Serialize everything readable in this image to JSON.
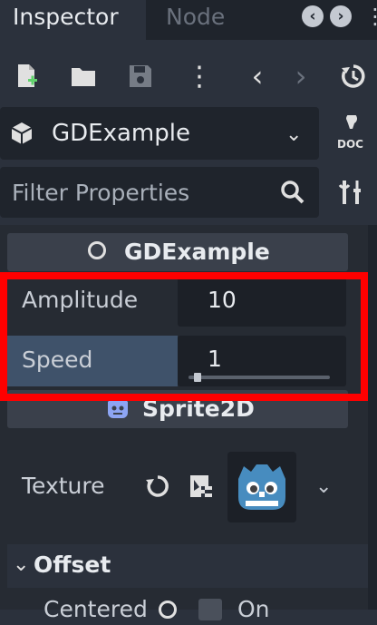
{
  "tabs": [
    {
      "label": "Inspector",
      "active": true
    },
    {
      "label": "Node",
      "active": false
    }
  ],
  "toolbar": {
    "icons": [
      "new-resource-icon",
      "open-folder-icon",
      "save-icon",
      "more-menu-icon",
      "history-back-icon",
      "history-forward-icon",
      "history-icon"
    ]
  },
  "object_selector": {
    "label": "GDExample",
    "doc_label": "DOC"
  },
  "filter": {
    "placeholder": "Filter Properties"
  },
  "sections": {
    "gdexample": {
      "title": "GDExample"
    },
    "sprite2d": {
      "title": "Sprite2D"
    },
    "offset": {
      "title": "Offset"
    }
  },
  "properties": {
    "amplitude": {
      "label": "Amplitude",
      "value": "10"
    },
    "speed": {
      "label": "Speed",
      "value": "1",
      "slider_fraction": 0.04
    },
    "texture": {
      "label": "Texture"
    },
    "centered": {
      "label": "Centered",
      "value": "On"
    }
  },
  "colors": {
    "highlight": "#ff0000",
    "speed_row": "#3f526a",
    "godot_blue": "#478cbf"
  }
}
